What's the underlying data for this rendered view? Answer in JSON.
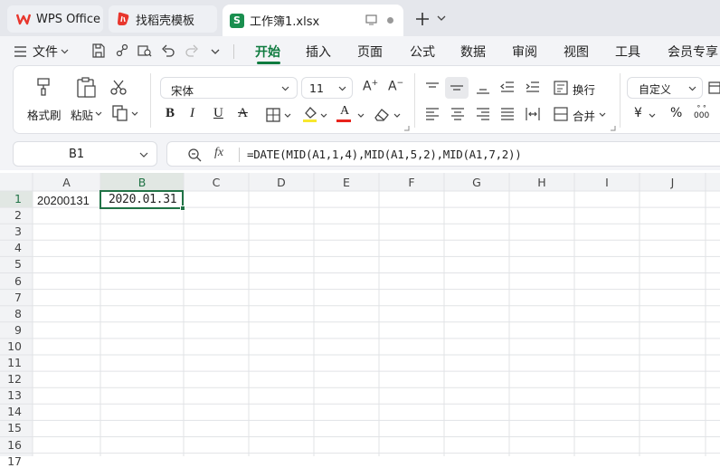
{
  "tabs": {
    "wps": "WPS Office",
    "template": "找稻壳模板",
    "workbook": "工作簿1.xlsx",
    "new_tab": "+"
  },
  "menu": {
    "file": "文件",
    "items": [
      "开始",
      "插入",
      "页面",
      "公式",
      "数据",
      "审阅",
      "视图",
      "工具",
      "会员专享"
    ],
    "active": "开始"
  },
  "toolbar": {
    "format_painter": "格式刷",
    "paste": "粘贴",
    "font_name": "宋体",
    "font_size": "11",
    "wrap": "换行",
    "merge": "合并",
    "number_format": "自定义",
    "currency": "¥",
    "percent": "%",
    "thousands": "000"
  },
  "formula_bar": {
    "name_box": "B1",
    "fx": "fx",
    "formula": "=DATE(MID(A1,1,4),MID(A1,5,2),MID(A1,7,2))"
  },
  "sheet": {
    "columns": [
      "A",
      "B",
      "C",
      "D",
      "E",
      "F",
      "G",
      "H",
      "I",
      "J"
    ],
    "rows": [
      "1",
      "2",
      "3",
      "4",
      "5",
      "6",
      "7",
      "8",
      "9",
      "10",
      "11",
      "12",
      "13",
      "14",
      "15",
      "16",
      "17"
    ],
    "cells": {
      "A1": "20200131",
      "B1": "2020.01.31"
    },
    "selected_cell": "B1"
  },
  "colors": {
    "accent": "#0f7b3f",
    "selection": "#217346",
    "wps_red": "#e8362d",
    "sheet_green": "#1a8f4f"
  }
}
